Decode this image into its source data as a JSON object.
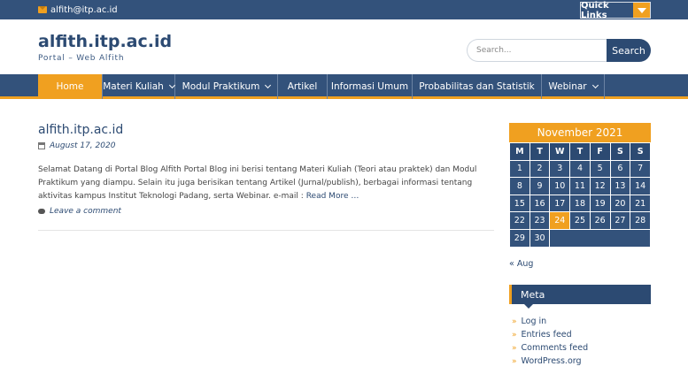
{
  "topbar": {
    "email": "alfith@itp.ac.id",
    "quick_links_label": "Quick Links"
  },
  "header": {
    "site_title": "alfith.itp.ac.id",
    "site_description": "Portal – Web Alfith",
    "search_placeholder": "Search...",
    "search_button": "Search"
  },
  "nav": {
    "items": [
      {
        "label": "Home",
        "active": true,
        "dropdown": false
      },
      {
        "label": "Materi Kuliah",
        "active": false,
        "dropdown": true
      },
      {
        "label": "Modul Praktikum",
        "active": false,
        "dropdown": true
      },
      {
        "label": "Artikel",
        "active": false,
        "dropdown": false
      },
      {
        "label": "Informasi Umum",
        "active": false,
        "dropdown": false
      },
      {
        "label": "Probabilitas dan Statistik",
        "active": false,
        "dropdown": false
      },
      {
        "label": "Webinar",
        "active": false,
        "dropdown": true
      }
    ]
  },
  "post": {
    "title": "alfith.itp.ac.id",
    "date": "August 17, 2020",
    "excerpt": "Selamat Datang di Portal Blog Alfith Portal Blog ini berisi tentang Materi Kuliah (Teori atau praktek) dan Modul Praktikum yang diampu. Selain itu juga berisikan tentang Artikel (Jurnal/publish), berbagai informasi tentang aktivitas kampus Institut Teknologi Padang, serta Webinar. e-mail :",
    "read_more": "Read More …",
    "comment_link": "Leave a comment"
  },
  "calendar": {
    "caption": "November 2021",
    "weekdays": [
      "M",
      "T",
      "W",
      "T",
      "F",
      "S",
      "S"
    ],
    "weeks": [
      [
        "1",
        "2",
        "3",
        "4",
        "5",
        "6",
        "7"
      ],
      [
        "8",
        "9",
        "10",
        "11",
        "12",
        "13",
        "14"
      ],
      [
        "15",
        "16",
        "17",
        "18",
        "19",
        "20",
        "21"
      ],
      [
        "22",
        "23",
        "24",
        "25",
        "26",
        "27",
        "28"
      ],
      [
        "29",
        "30",
        "",
        "",
        "",
        "",
        ""
      ]
    ],
    "today": "24",
    "prev_link": "« Aug"
  },
  "meta": {
    "title": "Meta",
    "links": [
      "Log in",
      "Entries feed",
      "Comments feed",
      "WordPress.org"
    ]
  },
  "colors": {
    "primary": "#33527b",
    "accent": "#f0a020"
  }
}
